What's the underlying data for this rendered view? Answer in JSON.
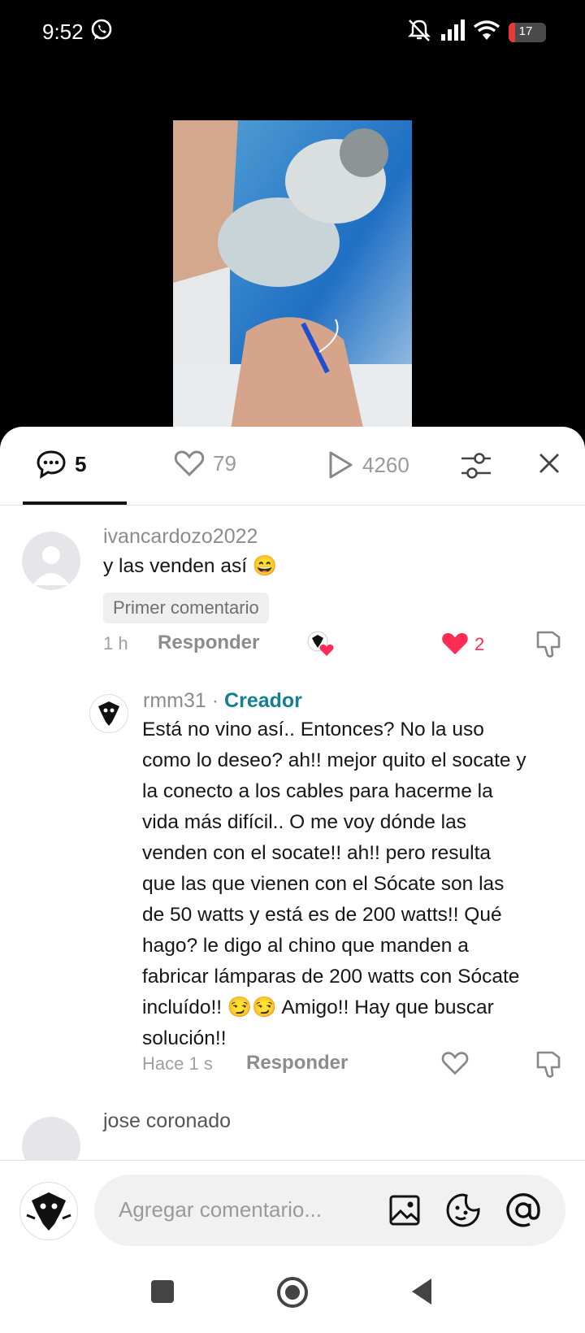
{
  "status_bar": {
    "time": "9:52",
    "battery": "17"
  },
  "tabs": {
    "comments": "5",
    "likes": "79",
    "views": "4260"
  },
  "comments": [
    {
      "username": "ivancardozo2022",
      "text": "y las venden así 😄",
      "badge": "Primer comentario",
      "time": "1 h",
      "reply": "Responder",
      "likes": "2"
    },
    {
      "username": "rmm31",
      "separator": "·",
      "role": "Creador",
      "lines": [
        "Está no vino así.. Entonces? No la uso",
        "como lo deseo? ah!! mejor quito el socate y",
        "la conecto a los cables para hacerme la",
        "vida más difícil.. O me voy dónde las",
        "venden con el socate!! ah!! pero resulta",
        "que las que vienen con el Sócate son las",
        "de 50 watts y está es de 200 watts!! Qué",
        "hago? le digo al chino que manden a",
        "fabricar lámparas de 200 watts con Sócate",
        "incluído!! 😏😏 Amigo!! Hay que buscar",
        "solución!!"
      ],
      "time": "Hace 1 s",
      "reply": "Responder"
    },
    {
      "username": "jose coronado"
    }
  ],
  "input": {
    "placeholder": "Agregar comentario..."
  },
  "colors": {
    "like_red": "#fe2c55",
    "creator_teal": "#157f91",
    "battery_red": "#e53935"
  }
}
